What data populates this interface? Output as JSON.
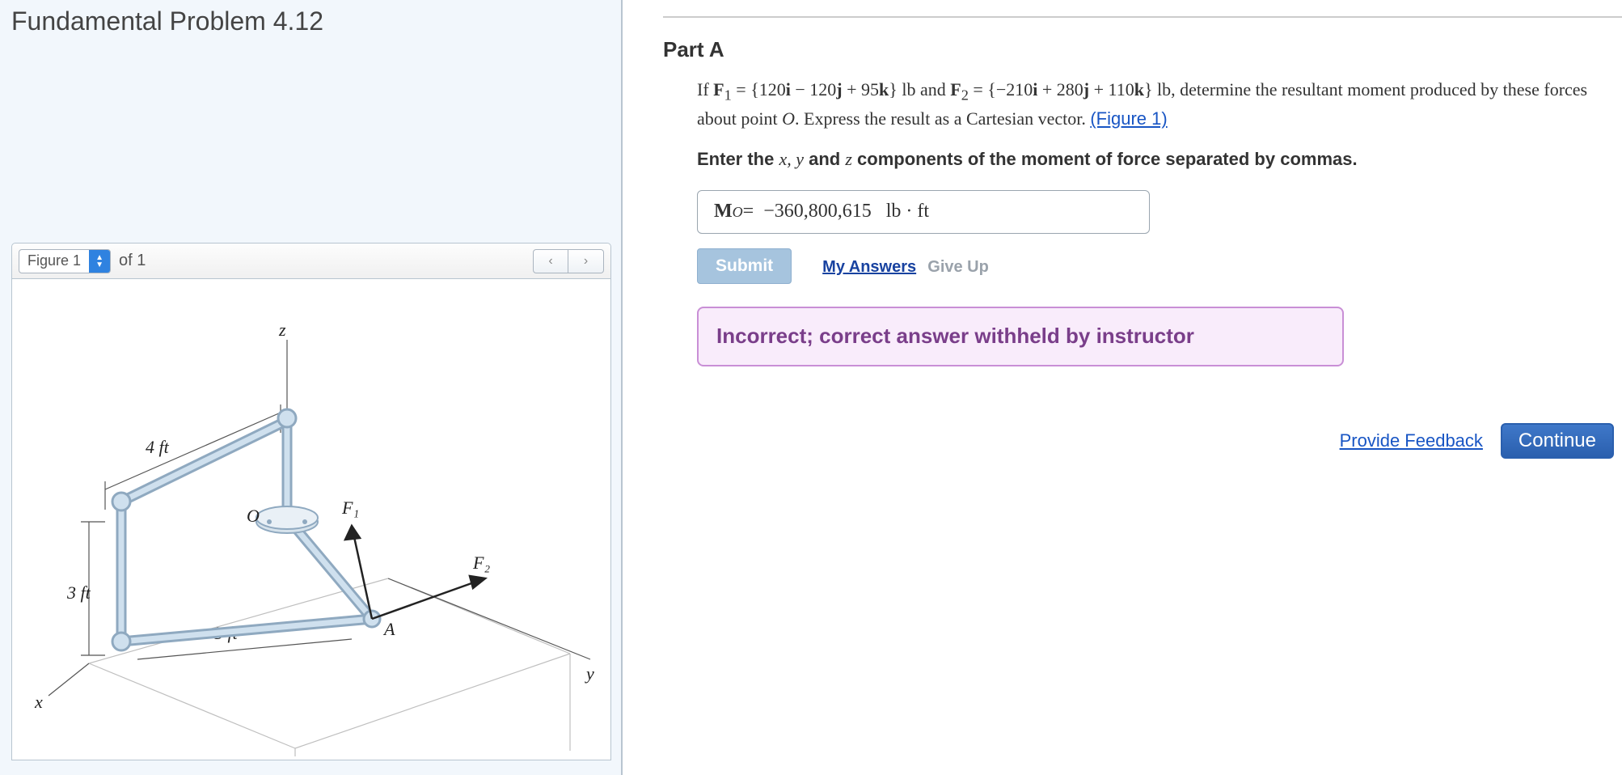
{
  "title": "Fundamental Problem 4.12",
  "figure": {
    "selector_label": "Figure 1",
    "count_label": "of 1",
    "prev_glyph": "‹",
    "next_glyph": "›",
    "labels": {
      "z": "z",
      "y": "y",
      "x": "x",
      "O": "O",
      "A": "A",
      "F1": "F₁",
      "F2": "F₂",
      "d1": "4 ft",
      "d2": "3 ft",
      "d3": "5 ft"
    }
  },
  "part": {
    "heading": "Part A",
    "prompt_html": "If <b>F</b><sub>1</sub> = {120<b>i</b>  −  120<b>j</b>  +  95<b>k</b>} lb and <b>F</b><sub>2</sub> = {−210<b>i</b>  +  280<b>j</b>  +  110<b>k</b>} lb, determine the resultant moment produced by these forces about point <i>O</i>. Express the result as a Cartesian vector. ",
    "figure_link": "(Figure 1)",
    "enter_prefix": "Enter the ",
    "enter_vars": "x, y",
    "enter_mid": " and ",
    "enter_var_z": "z",
    "enter_suffix": " components of the moment of force separated by commas.",
    "answer_symbol": "M",
    "answer_sub": "O",
    "answer_eq": " = ",
    "answer_value": "−360,800,615",
    "answer_units": "lb · ft",
    "submit": "Submit",
    "my_answers": "My Answers",
    "give_up": "Give Up",
    "feedback": "Incorrect; correct answer withheld by instructor"
  },
  "footer": {
    "provide_feedback": "Provide Feedback",
    "continue": "Continue"
  }
}
